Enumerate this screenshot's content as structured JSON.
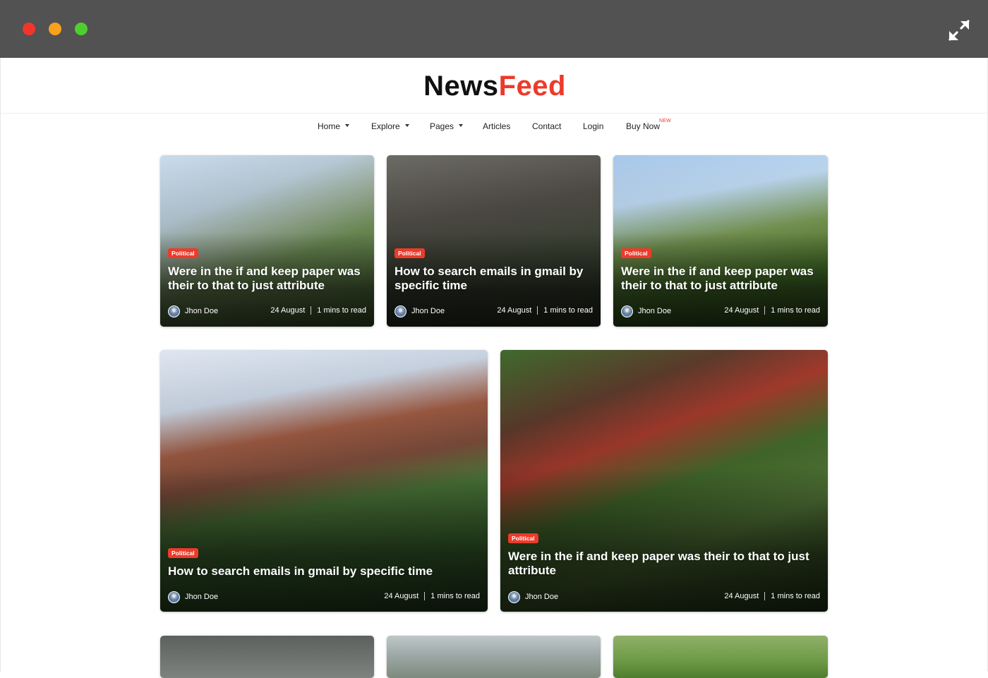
{
  "window": {
    "controls": [
      "close",
      "minimize",
      "zoom"
    ],
    "expand_icon": "expand-arrows-icon"
  },
  "logo": {
    "part1": "News",
    "part2": "Feed",
    "accent_color": "#ec3b2b"
  },
  "nav": {
    "items": [
      {
        "label": "Home",
        "dropdown": true
      },
      {
        "label": "Explore",
        "dropdown": true
      },
      {
        "label": "Pages",
        "dropdown": true
      },
      {
        "label": "Articles",
        "dropdown": false
      },
      {
        "label": "Contact",
        "dropdown": false
      },
      {
        "label": "Login",
        "dropdown": false
      },
      {
        "label": "Buy Now",
        "dropdown": false,
        "badge": "NEW"
      }
    ]
  },
  "cards": [
    {
      "category": "Political",
      "title": "Were in the if and keep paper was their to that to just attribute",
      "author": "Jhon Doe",
      "date": "24 August",
      "read_time": "1 mins to read"
    },
    {
      "category": "Political",
      "title": "How to search emails in gmail by specific time",
      "author": "Jhon Doe",
      "date": "24 August",
      "read_time": "1 mins to read"
    },
    {
      "category": "Political",
      "title": "Were in the if and keep paper was their to that to just attribute",
      "author": "Jhon Doe",
      "date": "24 August",
      "read_time": "1 mins to read"
    },
    {
      "category": "Political",
      "title": "How to search emails in gmail by specific time",
      "author": "Jhon Doe",
      "date": "24 August",
      "read_time": "1 mins to read"
    },
    {
      "category": "Political",
      "title": "Were in the if and keep paper was their to that to just attribute",
      "author": "Jhon Doe",
      "date": "24 August",
      "read_time": "1 mins to read"
    }
  ]
}
